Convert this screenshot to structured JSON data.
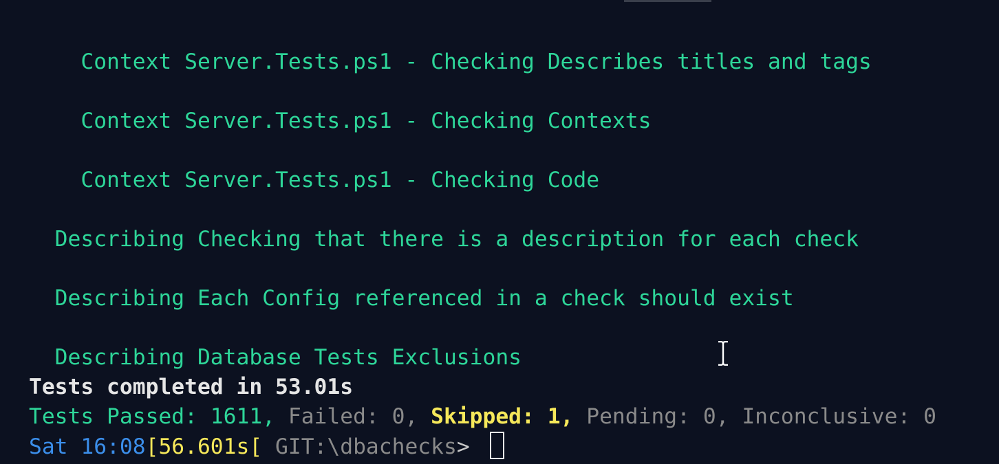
{
  "terminal": {
    "lines": [
      {
        "text": "    Context Server.Tests.ps1 - Checking Describes titles and tags"
      },
      {
        "text": "    Context Server.Tests.ps1 - Checking Contexts"
      },
      {
        "text": "    Context Server.Tests.ps1 - Checking Code"
      },
      {
        "text": "  Describing Checking that there is a description for each check"
      },
      {
        "text": "  Describing Each Config referenced in a check should exist"
      },
      {
        "text": "  Describing Database Tests Exclusions"
      }
    ],
    "summary": {
      "completed": "Tests completed in 53.01s",
      "passed": "Tests Passed: 1611,",
      "failed": " Failed: 0,",
      "skipped": " Skipped: 1,",
      "rest": " Pending: 0, Inconclusive: 0"
    },
    "prompt": {
      "day": "Sat",
      "time": "16:08",
      "bracket_open": "[",
      "duration": "56.601s",
      "bracket_open2": "[",
      "path": " GIT:\\dbachecks",
      "symbol": "> "
    },
    "colors": {
      "background": "#0c1120",
      "green": "#2ed699",
      "yellow": "#f6e85a",
      "blue": "#3b8eea",
      "grey": "#8a8a8a"
    },
    "icons": {
      "mouse_cursor": "i-beam-cursor-icon",
      "text_cursor": "block-cursor-icon"
    }
  }
}
